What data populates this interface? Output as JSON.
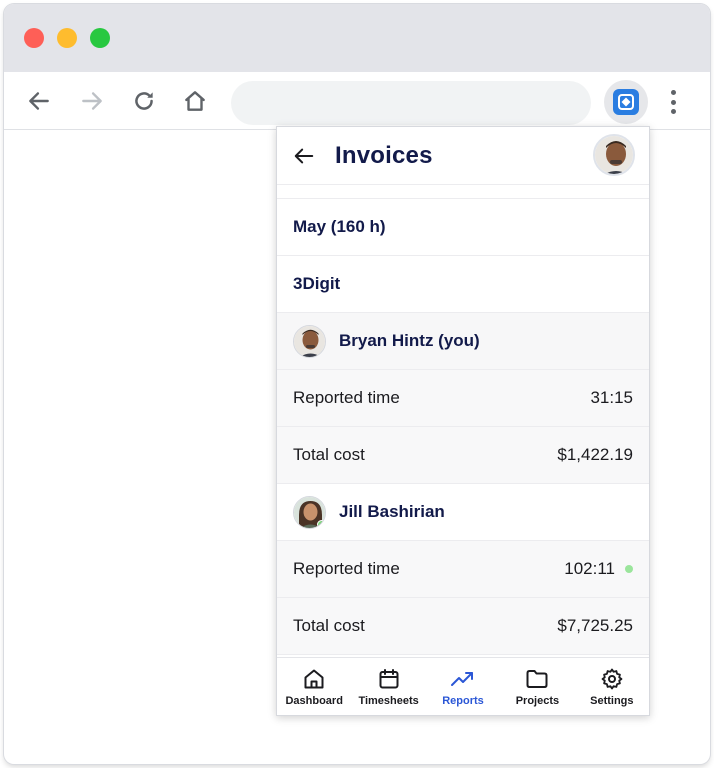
{
  "browser": {
    "address_value": ""
  },
  "popup": {
    "title": "Invoices",
    "period": "May (160 h)",
    "company": "3Digit",
    "members": [
      {
        "name": "Bryan Hintz (you)",
        "reported_time_label": "Reported time",
        "reported_time": "31:15",
        "total_cost_label": "Total cost",
        "total_cost": "$1,422.19"
      },
      {
        "name": "Jill Bashirian",
        "reported_time_label": "Reported time",
        "reported_time": "102:11",
        "total_cost_label": "Total cost",
        "total_cost": "$7,725.25"
      }
    ]
  },
  "nav": {
    "items": [
      {
        "label": "Dashboard",
        "icon": "home-icon"
      },
      {
        "label": "Timesheets",
        "icon": "calendar-icon"
      },
      {
        "label": "Reports",
        "icon": "trending-up-icon",
        "active": true
      },
      {
        "label": "Projects",
        "icon": "folder-icon"
      },
      {
        "label": "Settings",
        "icon": "gear-icon"
      }
    ]
  },
  "colors": {
    "title": "#121a4a",
    "active_nav": "#2b57d6",
    "online": "#9be59c",
    "extension": "#2a7de1"
  }
}
